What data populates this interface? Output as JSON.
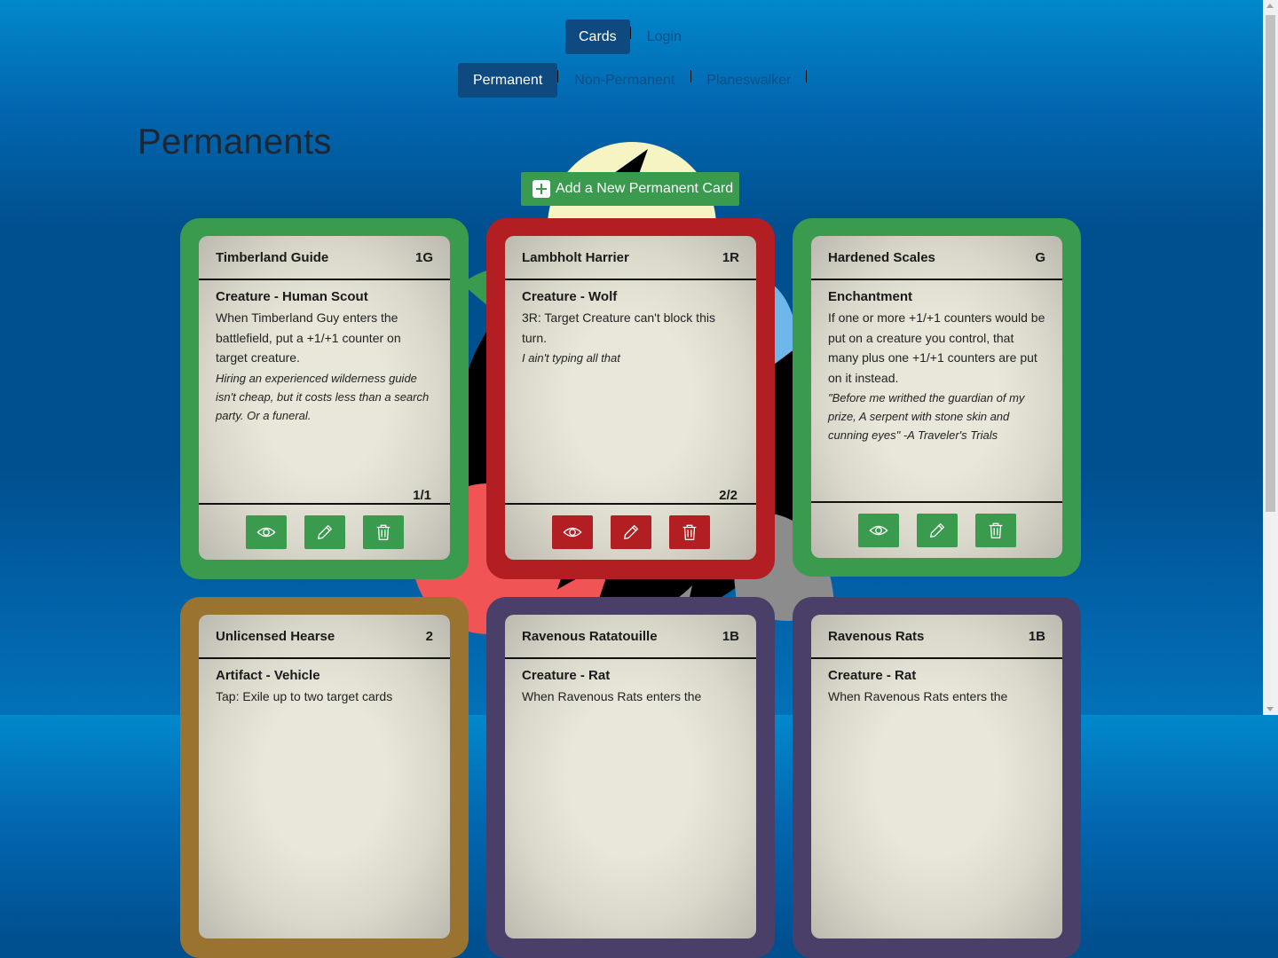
{
  "nav": {
    "main": [
      {
        "label": "Cards"
      },
      {
        "label": "Login"
      }
    ],
    "sub": [
      {
        "label": "Permanent"
      },
      {
        "label": "Non-Permanent"
      },
      {
        "label": "Planeswalker"
      }
    ]
  },
  "page_title": "Permanents",
  "add_button_label": "Add a New Permanent Card",
  "colors": {
    "green": "#3a9a4e",
    "red": "#b31e22",
    "brown": "#9a7330",
    "purple": "#4a3f68"
  },
  "cards": [
    {
      "name": "Timberland Guide",
      "cost": "1G",
      "type": "Creature - Human Scout",
      "text": "When Timberland Guy enters the battlefield, put a +1/+1 counter on target creature.",
      "flavor": "Hiring an experienced wilderness guide isn't cheap, but it costs less than a search party. Or a funeral.",
      "pt": "1/1",
      "color": "green"
    },
    {
      "name": "Lambholt Harrier",
      "cost": "1R",
      "type": "Creature - Wolf",
      "text": "3R: Target Creature can't block this turn.",
      "flavor": "I ain't typing all that",
      "pt": "2/2",
      "color": "red"
    },
    {
      "name": "Hardened Scales",
      "cost": "G",
      "type": "Enchantment",
      "text": "If one or more +1/+1 counters would be put on a creature you control, that many plus one +1/+1 counters are put on it instead.",
      "flavor": "\"Before me writhed the guardian of my prize, A serpent with stone skin and cunning eyes\" -A Traveler's Trials",
      "pt": "",
      "color": "green"
    },
    {
      "name": "Unlicensed Hearse",
      "cost": "2",
      "type": "Artifact - Vehicle",
      "text": "Tap: Exile up to two target cards",
      "color": "brown"
    },
    {
      "name": "Ravenous Ratatouille",
      "cost": "1B",
      "type": "Creature - Rat",
      "text": "When Ravenous Rats enters the",
      "color": "purple"
    },
    {
      "name": "Ravenous Rats",
      "cost": "1B",
      "type": "Creature - Rat",
      "text": "When Ravenous Rats enters the",
      "color": "purple"
    }
  ]
}
